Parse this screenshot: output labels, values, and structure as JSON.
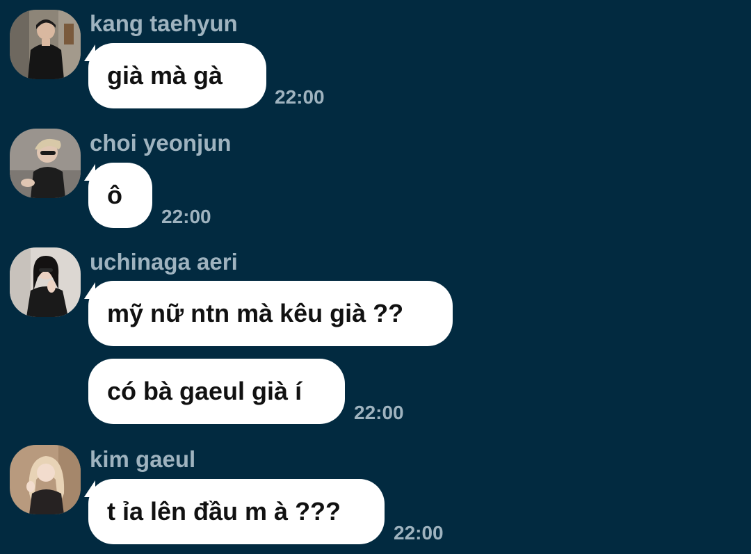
{
  "theme": {
    "background": "#022a40",
    "bubble": "#ffffff",
    "meta_text": "#9fb3bf",
    "message_text": "#111111"
  },
  "messages": [
    {
      "sender": "kang taehyun",
      "avatar": "avatar-photo",
      "bubbles": [
        "già mà gà"
      ],
      "time": "22:00"
    },
    {
      "sender": "choi yeonjun",
      "avatar": "avatar-photo",
      "bubbles": [
        "ô"
      ],
      "time": "22:00"
    },
    {
      "sender": "uchinaga aeri",
      "avatar": "avatar-photo",
      "bubbles": [
        "mỹ nữ ntn mà kêu già ??",
        "có bà gaeul già í"
      ],
      "time": "22:00"
    },
    {
      "sender": "kim gaeul",
      "avatar": "avatar-photo",
      "bubbles": [
        "t ỉa lên đầu m à ???"
      ],
      "time": "22:00"
    }
  ]
}
